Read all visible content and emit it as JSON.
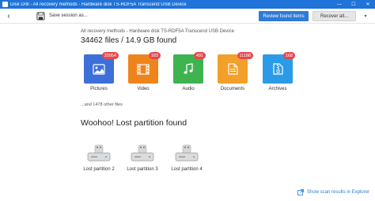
{
  "window": {
    "title": "Disk Drill - All recovery methods - Hardware disk TS-RDF5A Transcend USB Device",
    "minimize": "—",
    "maximize": "☐",
    "close": "✕"
  },
  "toolbar": {
    "back_icon": "‹",
    "save_label": "Save session as...",
    "review_label": "Review found items",
    "recover_label": "Recover all...",
    "recover_chevron": "▾"
  },
  "breadcrumb": "All recovery methods - Hardware disk TS-RDF5A Transcend USB Device",
  "summary": "34462 files / 14.9 GB found",
  "categories": [
    {
      "label": "Pictures",
      "count": "20954",
      "color": "#3d6fd9",
      "icon": "picture-icon"
    },
    {
      "label": "Video",
      "count": "183",
      "color": "#f0841c",
      "icon": "film-icon"
    },
    {
      "label": "Audio",
      "count": "491",
      "color": "#3fb34f",
      "icon": "music-icon"
    },
    {
      "label": "Documents",
      "count": "11188",
      "color": "#f2a02a",
      "icon": "document-icon"
    },
    {
      "label": "Archives",
      "count": "168",
      "color": "#2b9be8",
      "icon": "archive-icon"
    }
  ],
  "other_files": "...and 1478 other files",
  "partition_heading": "Woohoo! Lost partition found",
  "partitions": [
    {
      "label": "Lost partition 2"
    },
    {
      "label": "Lost partition 3"
    },
    {
      "label": "Lost partition 4"
    }
  ],
  "footer_link": "Show scan results in Explorer"
}
